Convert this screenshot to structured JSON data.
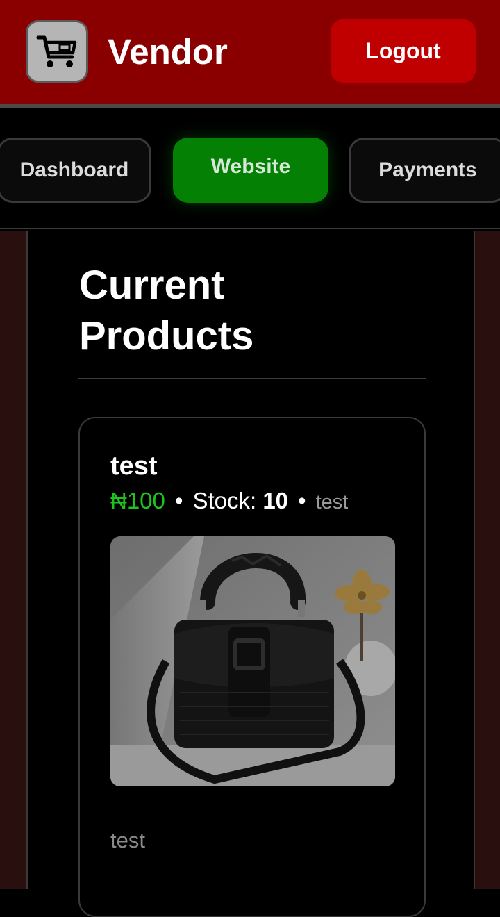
{
  "header": {
    "brand": "Vendor",
    "logout_label": "Logout",
    "logo_icon": "shopping-cart-icon"
  },
  "nav": {
    "tabs": [
      {
        "label": "Dashboard",
        "active": false
      },
      {
        "label": "Website",
        "active": true
      },
      {
        "label": "Payments",
        "active": false
      }
    ]
  },
  "main": {
    "title": "Current Products",
    "products": [
      {
        "name": "test",
        "price": "₦100",
        "stock_label": "Stock:",
        "stock_value": "10",
        "category": "test",
        "description": "test",
        "image": "black-handbag-photo"
      }
    ]
  },
  "colors": {
    "header_bg": "#8a0000",
    "logout_bg": "#c00000",
    "active_tab": "#048004",
    "price": "#1ec31e",
    "side_panel": "#2a0f0f"
  }
}
